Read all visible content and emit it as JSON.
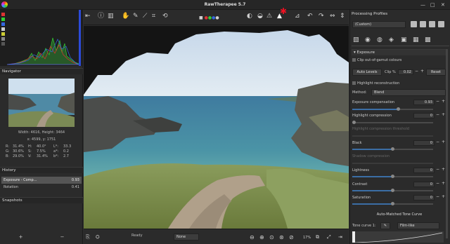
{
  "app": {
    "title": "RawTherapee 5.7",
    "minimize": "—",
    "maximize": "□",
    "close": "✕"
  },
  "navigator": {
    "label": "Navigator",
    "dims": "Width: 4616, Height: 3464",
    "coords": "x: 4599, y: 1751",
    "values": [
      [
        "R:",
        "31.4%",
        "H:",
        "40.0°",
        "L*:",
        "33.3"
      ],
      [
        "G:",
        "30.6%",
        "S:",
        "7.5%",
        "a*:",
        "0.2"
      ],
      [
        "B:",
        "29.0%",
        "V:",
        "31.4%",
        "b*:",
        "2.7"
      ]
    ]
  },
  "history": {
    "label": "History",
    "items": [
      {
        "name": "Exposure - Comp...",
        "value": "0.93"
      },
      {
        "name": "Rotation",
        "value": "0.41"
      }
    ]
  },
  "snapshots": {
    "label": "Snapshots",
    "add": "+",
    "remove": "−"
  },
  "status": {
    "ready": "Ready",
    "none": "None",
    "zoom": "17%"
  },
  "right": {
    "profiles_label": "Processing Profiles",
    "profile": "(Custom)",
    "exposure_label": "Exposure",
    "clip_label": "Clip out-of-gamut colours",
    "auto_levels": "Auto Levels",
    "clip_pct": "Clip %",
    "clip_val": "0.02",
    "reset": "Reset",
    "highlight_label": "Highlight reconstruction",
    "method_label": "Method:",
    "method": "Blend",
    "sliders": [
      {
        "label": "Exposure compensation",
        "value": "0.93",
        "dim": false
      },
      {
        "label": "Highlight compression",
        "value": "0",
        "dim": false
      },
      {
        "label": "Highlight compression threshold",
        "value": "",
        "dim": true
      },
      {
        "label": "Black",
        "value": "0",
        "dim": false
      },
      {
        "label": "Shadow compression",
        "value": "",
        "dim": true
      },
      {
        "label": "Lightness",
        "value": "0",
        "dim": false
      },
      {
        "label": "Contrast",
        "value": "0",
        "dim": false
      },
      {
        "label": "Saturation",
        "value": "0",
        "dim": false
      }
    ],
    "amtc_label": "Auto-Matched Tone Curve",
    "tone_curve_label": "Tone curve 1:",
    "tone_mode": "Film-like"
  }
}
